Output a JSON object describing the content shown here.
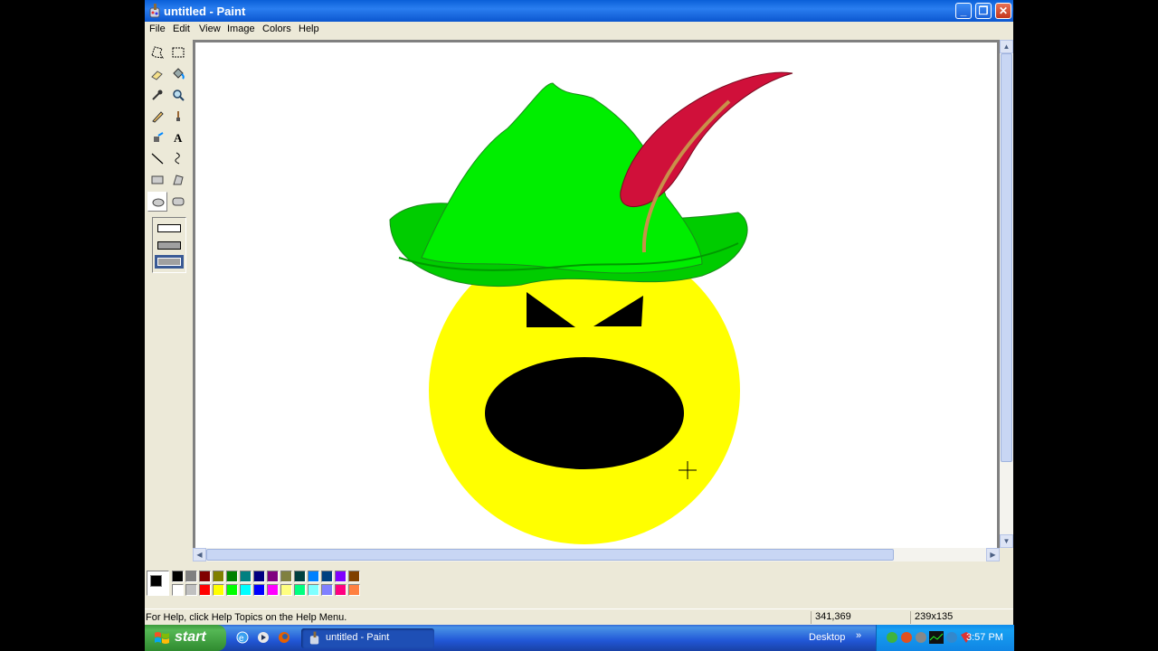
{
  "window": {
    "title": "untitled - Paint",
    "minimize": "_",
    "maximize": "❐",
    "close": "✕"
  },
  "menu": [
    "File",
    "Edit",
    "View",
    "Image",
    "Colors",
    "Help"
  ],
  "tools": [
    "free-form-select",
    "select",
    "eraser",
    "fill-with-color",
    "pick-color",
    "magnifier",
    "pencil",
    "brush",
    "airbrush",
    "text",
    "line",
    "curve",
    "rectangle",
    "polygon",
    "ellipse",
    "rounded-rectangle"
  ],
  "selected_tool": "ellipse",
  "palette": {
    "foreground": "#000000",
    "background": "#ffffff",
    "row1": [
      "#000000",
      "#808080",
      "#800000",
      "#808000",
      "#008000",
      "#008080",
      "#000080",
      "#800080",
      "#808040",
      "#004040",
      "#0080ff",
      "#004080",
      "#8000ff",
      "#804000"
    ],
    "row2": [
      "#ffffff",
      "#c0c0c0",
      "#ff0000",
      "#ffff00",
      "#00ff00",
      "#00ffff",
      "#0000ff",
      "#ff00ff",
      "#ffff80",
      "#00ff80",
      "#80ffff",
      "#8080ff",
      "#ff0080",
      "#ff8040"
    ]
  },
  "status": {
    "help": "For Help, click Help Topics on the Help Menu.",
    "coords": "341,369",
    "size": "239x135"
  },
  "taskbar": {
    "start": "start",
    "task": "untitled - Paint",
    "desktop": "Desktop",
    "clock": "3:57 PM"
  },
  "drawing": {
    "face_color": "#ffff00",
    "hat_color": "#00ee00",
    "hat_brim_color": "#00cc00",
    "feather_color": "#d0103a",
    "feather_quill_color": "#c8904a",
    "features_color": "#000000"
  }
}
